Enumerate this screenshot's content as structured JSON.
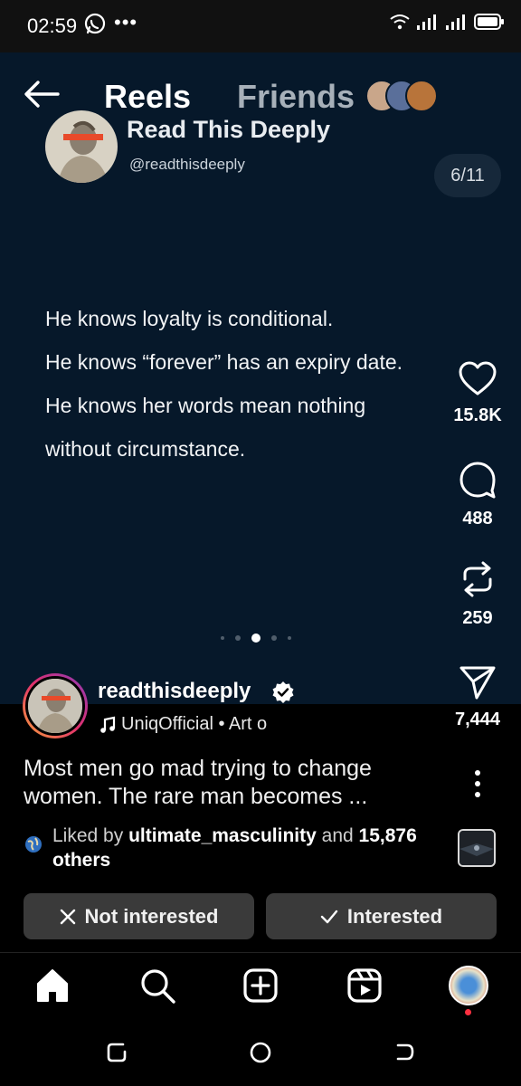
{
  "status_bar": {
    "time": "02:59",
    "more": "•••"
  },
  "header": {
    "tab_reels": "Reels",
    "tab_friends": "Friends"
  },
  "post_card": {
    "name": "Read This Deeply",
    "handle": "@readthisdeeply",
    "counter": "6/11",
    "quote_lines": [
      "He knows loyalty is conditional.",
      "He knows “forever” has an expiry date.",
      "He knows her words mean nothing",
      "without circumstance."
    ],
    "carousel": {
      "pages": 5,
      "active_index": 2
    }
  },
  "actions": {
    "likes": "15.8K",
    "comments": "488",
    "reposts": "259",
    "shares": "7,444"
  },
  "author": {
    "username": "readthisdeeply",
    "audio": "UniqOfficial • Art o"
  },
  "caption": "Most men go mad trying to change women. The rare man becomes ...",
  "liked_by": {
    "prefix": "Liked by",
    "user": "ultimate_masculinity",
    "middle": "and",
    "count": "15,876",
    "suffix": "others"
  },
  "buttons": {
    "not_interested": "Not interested",
    "interested": "Interested"
  },
  "colors": {
    "reel_bg": "#06182a",
    "button_bg": "#3a3a3a",
    "story_ring_start": "#f9a13a",
    "story_ring_end": "#8a3ab9",
    "notification_dot": "#ff3040"
  },
  "icons": [
    "back-arrow-icon",
    "heart-icon",
    "comment-icon",
    "repost-icon",
    "send-icon",
    "verified-icon",
    "music-note-icon",
    "more-vertical-icon",
    "globe-icon",
    "x-icon",
    "check-icon",
    "home-icon",
    "search-icon",
    "create-icon",
    "reels-icon"
  ]
}
